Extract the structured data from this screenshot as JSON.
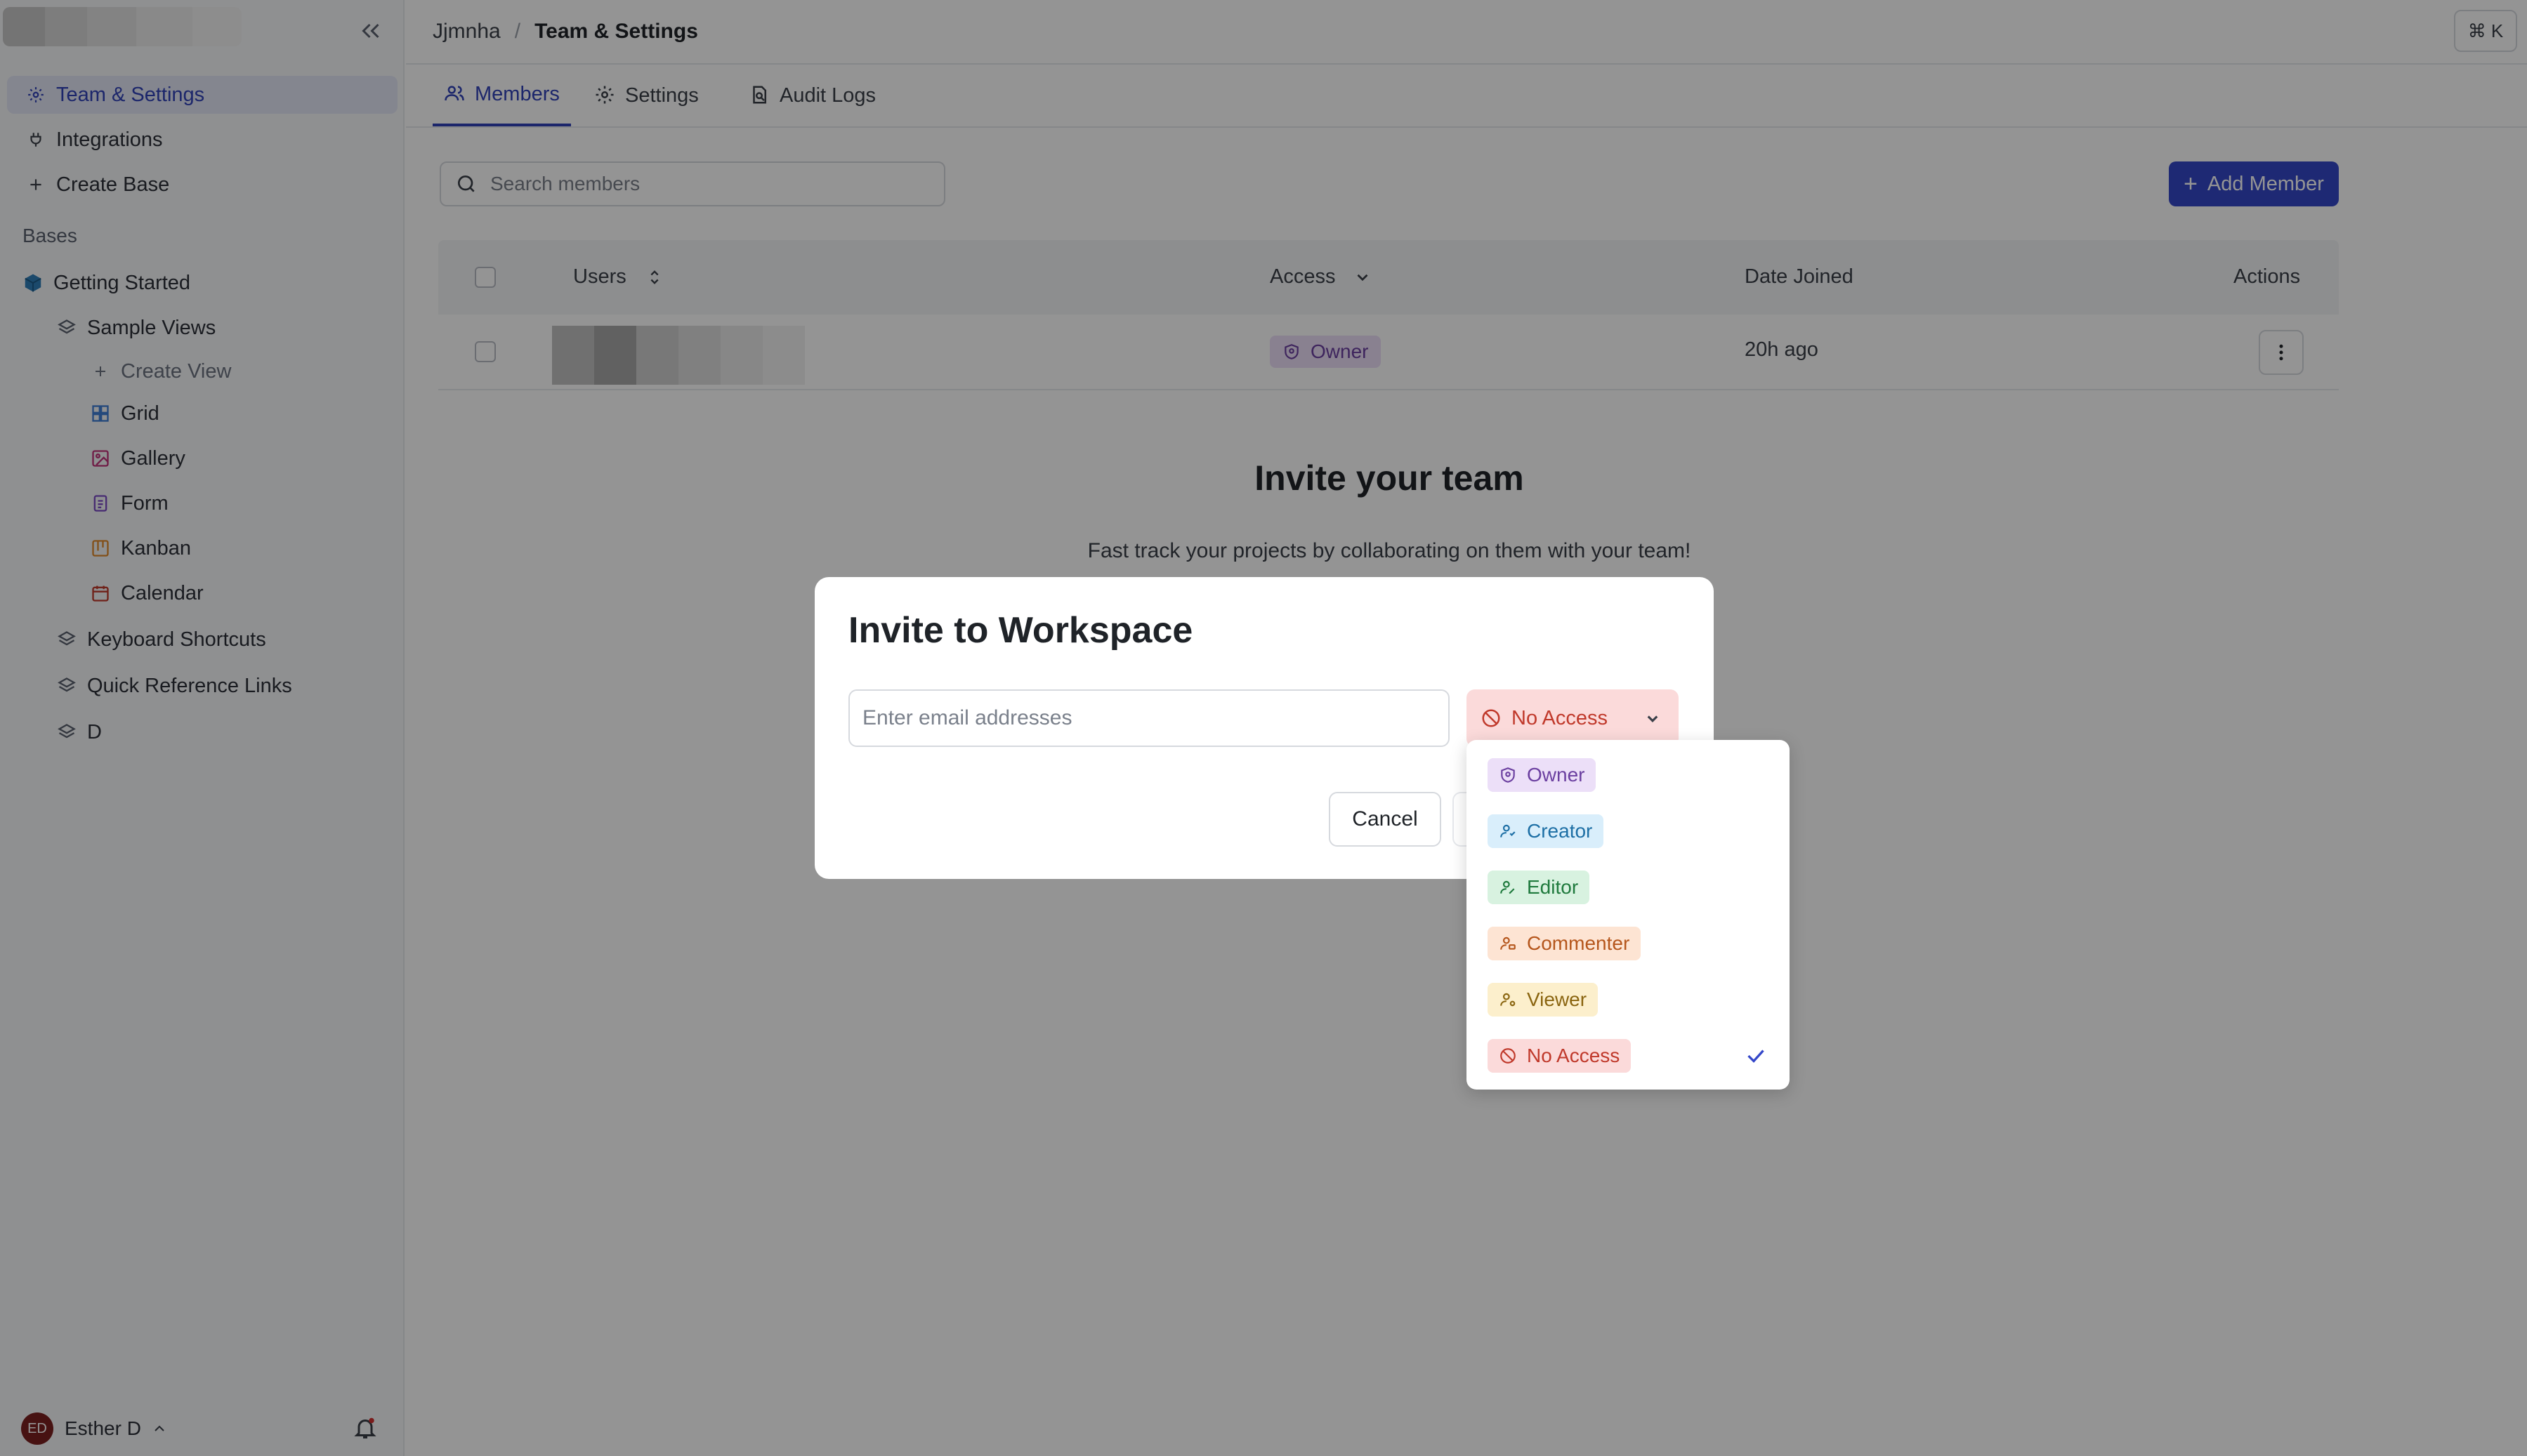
{
  "header": {
    "workspace": "Jjmnha",
    "separator": "/",
    "current_page": "Team & Settings",
    "shortcut": "⌘ K"
  },
  "sidebar": {
    "items": [
      {
        "label": "Team & Settings",
        "icon": "gear-icon",
        "active": true
      },
      {
        "label": "Integrations",
        "icon": "plug-icon"
      },
      {
        "label": "Create Base",
        "icon": "plus-icon"
      }
    ],
    "section_label": "Bases",
    "base": {
      "label": "Getting Started",
      "icon": "cube-icon"
    },
    "tree": [
      {
        "label": "Sample Views",
        "icon": "layers-icon"
      },
      {
        "label": "Create View",
        "icon": "plus-icon"
      },
      {
        "label": "Grid",
        "icon": "grid-icon"
      },
      {
        "label": "Gallery",
        "icon": "image-icon"
      },
      {
        "label": "Form",
        "icon": "form-icon"
      },
      {
        "label": "Kanban",
        "icon": "kanban-icon"
      },
      {
        "label": "Calendar",
        "icon": "calendar-icon"
      },
      {
        "label": "Keyboard Shortcuts",
        "icon": "layers-icon"
      },
      {
        "label": "Quick Reference Links",
        "icon": "layers-icon"
      },
      {
        "label": "D",
        "icon": "layers-icon"
      }
    ],
    "user": {
      "initials": "ED",
      "name": "Esther D"
    }
  },
  "tabs": [
    {
      "label": "Members",
      "icon": "users-icon",
      "active": true
    },
    {
      "label": "Settings",
      "icon": "gear-icon"
    },
    {
      "label": "Audit Logs",
      "icon": "audit-icon"
    }
  ],
  "toolbar": {
    "search_placeholder": "Search members",
    "add_member_label": "Add Member"
  },
  "table": {
    "columns": [
      "Users",
      "Access",
      "Date Joined",
      "Actions"
    ],
    "rows": [
      {
        "user": "",
        "access": "Owner",
        "date_joined": "20h ago"
      }
    ]
  },
  "empty_state": {
    "title": "Invite your team",
    "subtitle": "Fast track your projects by collaborating on them with your team!"
  },
  "modal": {
    "title": "Invite to Workspace",
    "email_placeholder": "Enter email addresses",
    "selected_access": "No Access",
    "cancel_label": "Cancel"
  },
  "dropdown": {
    "options": [
      {
        "label": "Owner",
        "bg": "#ecdff8",
        "fg": "#6b3fa0"
      },
      {
        "label": "Creator",
        "bg": "#d9eefb",
        "fg": "#1d6fa5"
      },
      {
        "label": "Editor",
        "bg": "#d8f2e0",
        "fg": "#1f7a3d"
      },
      {
        "label": "Commenter",
        "bg": "#fde4d3",
        "fg": "#b5561c"
      },
      {
        "label": "Viewer",
        "bg": "#fcefcc",
        "fg": "#8a6510"
      },
      {
        "label": "No Access",
        "bg": "#fbdada",
        "fg": "#c0392b",
        "selected": true
      }
    ]
  },
  "colors": {
    "accent": "#3447c9",
    "owner_pill": "#ecdff8",
    "no_access": "#fbdada"
  }
}
